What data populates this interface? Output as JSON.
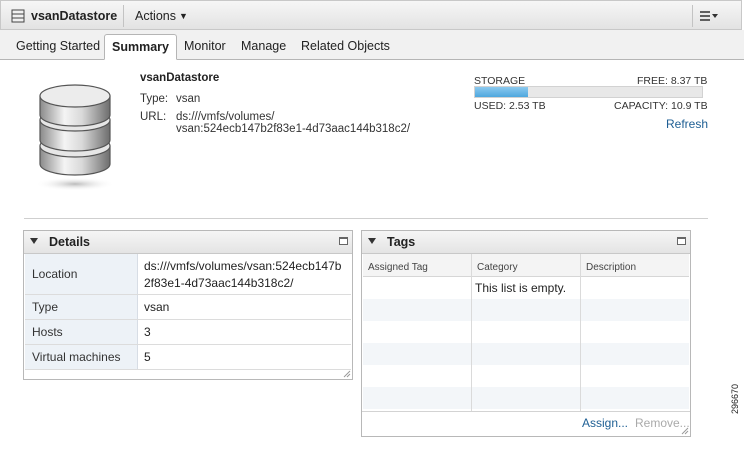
{
  "header": {
    "title": "vsanDatastore",
    "actions_label": "Actions",
    "icons": [
      "datastore-icon",
      "chevron-down-icon",
      "menu-list-icon"
    ]
  },
  "tabs": [
    {
      "label": "Getting Started",
      "active": false
    },
    {
      "label": "Summary",
      "active": true
    },
    {
      "label": "Monitor",
      "active": false
    },
    {
      "label": "Manage",
      "active": false
    },
    {
      "label": "Related Objects",
      "active": false
    }
  ],
  "summary": {
    "name": "vsanDatastore",
    "type_label": "Type:",
    "type_value": "vsan",
    "url_label": "URL:",
    "url_line1": "ds:///vmfs/volumes/",
    "url_line2": "vsan:524ecb147b2f83e1-4d73aac144b318c2/"
  },
  "storage": {
    "label": "STORAGE",
    "free": "FREE: 8.37 TB",
    "used": "USED: 2.53 TB",
    "capacity": "CAPACITY: 10.9 TB",
    "used_fraction": 0.232,
    "bar_color": "#5aaee2",
    "refresh_label": "Refresh"
  },
  "details": {
    "title": "Details",
    "rows": [
      {
        "key": "Location",
        "value_line1": "ds:///vmfs/volumes/vsan:524ecb147b",
        "value_line2": "2f83e1-4d73aac144b318c2/"
      },
      {
        "key": "Type",
        "value": "vsan"
      },
      {
        "key": "Hosts",
        "value": "3"
      },
      {
        "key": "Virtual machines",
        "value": "5"
      }
    ]
  },
  "tags": {
    "title": "Tags",
    "columns": [
      "Assigned Tag",
      "Category",
      "Description"
    ],
    "empty_message": "This list is empty.",
    "assign_label": "Assign...",
    "remove_label": "Remove..."
  },
  "side_number": "296670",
  "colors": {
    "link": "#1e5f94",
    "panel_header": "#e4e4e4",
    "key_cell": "#edf2f7"
  }
}
